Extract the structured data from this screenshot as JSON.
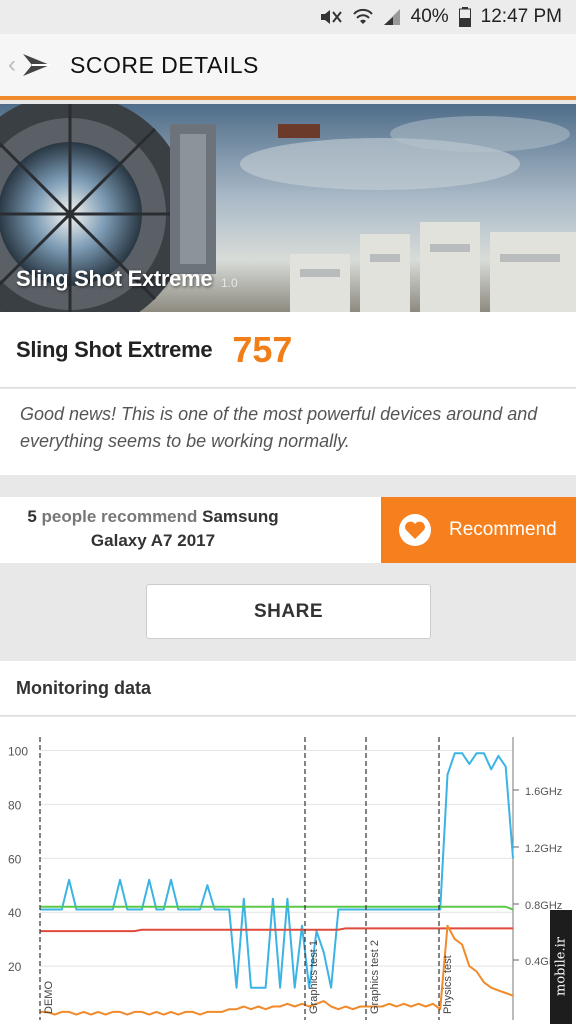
{
  "status_bar": {
    "battery": "40%",
    "time": "12:47 PM",
    "icons": [
      "mute-icon",
      "wifi-icon",
      "signal-icon",
      "battery-icon"
    ]
  },
  "app_bar": {
    "title": "SCORE DETAILS",
    "icons": [
      "back-icon",
      "3dmark-logo-icon"
    ]
  },
  "hero": {
    "title": "Sling Shot Extreme",
    "version": "1.0"
  },
  "score": {
    "name": "Sling Shot Extreme",
    "value": "757"
  },
  "message": "Good news! This is one of the most powerful devices around and everything seems to be working normally.",
  "recommend": {
    "count": "5",
    "text_middle": "people recommend",
    "device_a": "Samsung",
    "device_b": "Galaxy A7 2017",
    "button_label": "Recommend"
  },
  "share_label": "SHARE",
  "monitoring": {
    "title": "Monitoring data"
  },
  "chart_data": {
    "type": "line",
    "left_axis_ticks": [
      "100",
      "80",
      "60",
      "40",
      "20"
    ],
    "right_axis_ticks": [
      "1.6GHz",
      "1.2GHz",
      "0.8GHz",
      "0.4GHz"
    ],
    "ylim_left": [
      0,
      105
    ],
    "markers": [
      "DEMO",
      "Graphics test 1",
      "Graphics test 2",
      "Physics test"
    ],
    "series": [
      {
        "color": "#3bb4e5",
        "values": [
          41,
          41,
          41,
          41,
          52,
          41,
          41,
          41,
          41,
          41,
          41,
          52,
          41,
          41,
          41,
          52,
          41,
          41,
          52,
          41,
          41,
          41,
          41,
          50,
          41,
          41,
          41,
          12,
          45,
          12,
          12,
          12,
          45,
          12,
          45,
          12,
          35,
          12,
          33,
          25,
          12,
          41,
          41,
          41,
          41,
          41,
          41,
          41,
          41,
          41,
          41,
          41,
          41,
          41,
          41,
          41,
          91,
          99,
          99,
          95,
          99,
          99,
          93,
          98,
          94,
          60
        ]
      },
      {
        "color": "#5cc84a",
        "values": [
          42,
          42,
          42,
          42,
          42,
          42,
          42,
          42,
          42,
          42,
          42,
          42,
          42,
          42,
          42,
          42,
          42,
          42,
          42,
          42,
          42,
          42,
          42,
          42,
          42,
          42,
          42,
          42,
          42,
          42,
          42,
          42,
          42,
          42,
          42,
          42,
          42,
          42,
          42,
          42,
          42,
          42,
          42,
          42,
          42,
          42,
          42,
          42,
          42,
          42,
          42,
          42,
          42,
          42,
          42,
          42,
          42,
          42,
          42,
          42,
          42,
          42,
          42,
          42,
          42,
          41
        ]
      },
      {
        "color": "#e04a3a",
        "values": [
          33,
          33,
          33,
          33,
          33,
          33,
          33,
          33,
          33,
          33,
          33,
          33,
          33,
          33,
          33.5,
          33.5,
          33.5,
          33.5,
          33.5,
          33.5,
          33.5,
          33.5,
          33.5,
          33.5,
          33.5,
          33.5,
          33.5,
          33.5,
          33.5,
          33.5,
          33.5,
          33.5,
          33.5,
          33.5,
          33.5,
          33.5,
          33.5,
          33.5,
          33.5,
          33.5,
          33.5,
          33.5,
          34,
          34,
          34,
          34,
          34,
          34,
          34,
          34,
          34,
          34,
          34,
          34,
          34,
          34,
          34,
          34,
          34,
          34,
          34,
          34,
          34,
          34,
          34,
          34
        ]
      },
      {
        "color": "#f08a2a",
        "values": [
          3,
          3,
          2,
          3,
          3,
          2,
          3,
          2,
          3,
          2,
          3,
          3,
          2,
          3,
          3,
          2,
          3,
          2,
          3,
          2,
          3,
          3,
          2,
          3,
          3,
          3,
          4,
          4,
          5,
          4,
          5,
          4,
          5,
          5,
          6,
          5,
          6,
          5,
          6,
          7,
          5,
          4,
          5,
          4,
          5,
          5,
          5,
          5,
          6,
          5,
          6,
          5,
          6,
          5,
          6,
          4,
          35,
          30,
          28,
          20,
          18,
          14,
          12,
          11,
          10,
          9
        ]
      }
    ]
  }
}
